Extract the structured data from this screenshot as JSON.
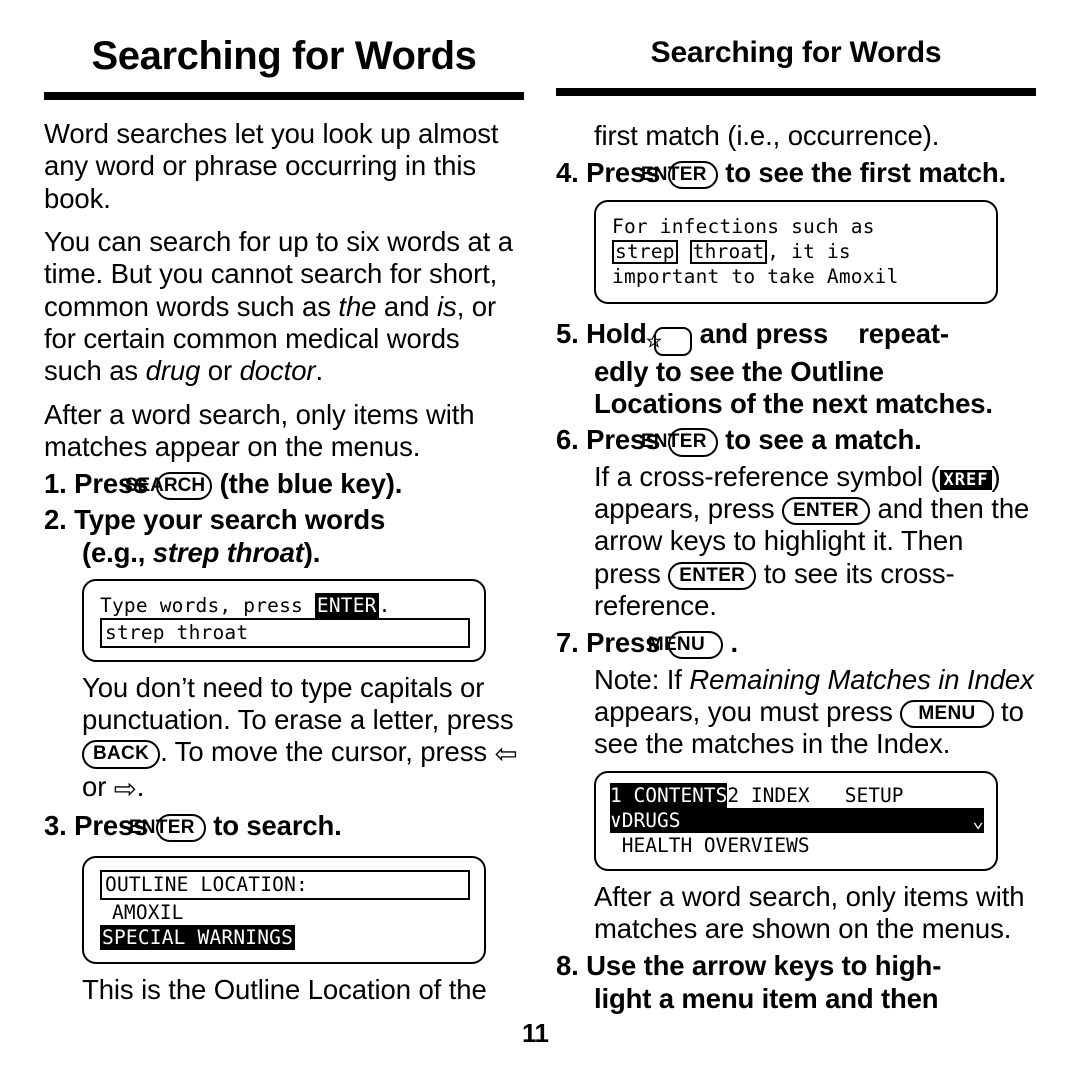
{
  "page": {
    "number": "11"
  },
  "left_column": {
    "heading": "Searching for Words",
    "intro_1": "Word searches let you look up almost any word or phrase occurring in this book.",
    "intro_2_a": "You can search for up to six words at a time. But you cannot search for short, common words such as ",
    "intro_2_i1": "the",
    "intro_2_b": " and ",
    "intro_2_i2": "is",
    "intro_2_c": ", or for certain common medical words such as ",
    "intro_2_i3": "drug",
    "intro_2_d": " or ",
    "intro_2_i4": "doctor",
    "intro_2_e": ".",
    "intro_3": "After a word search, only items with matches appear on the menus.",
    "step1": {
      "num": "1.",
      "pre": "Press",
      "key": "SEARCH",
      "post": "(the blue key)."
    },
    "step2": {
      "num": "2.",
      "line1": "Type your search words",
      "line2_pre": "(e.g., ",
      "line2_ital": "strep throat",
      "line2_post": ")."
    },
    "lcd_type": {
      "line1_a": "Type words, press ",
      "line1_key": "ENTER",
      "line1_b": ".",
      "field_value": "strep throat"
    },
    "note_after_lcd_a": "You don’t need to type capitals or punctuation. To erase a letter, press ",
    "note_after_lcd_key": "BACK",
    "note_after_lcd_b": ". To move the cursor, press ",
    "note_arrow_left": "⇦",
    "note_after_lcd_c": " or ",
    "note_arrow_right": "⇨",
    "note_after_lcd_d": ".",
    "step3": {
      "num": "3.",
      "pre": "Press",
      "key": "ENTER",
      "post": "to search."
    },
    "lcd_outline": {
      "header": "OUTLINE LOCATION:",
      "row1": "AMOXIL",
      "row2": "SPECIAL WARNINGS"
    },
    "closing": "This is the Outline Location of the"
  },
  "right_column": {
    "heading": "Searching for Words",
    "cont_line": "first match (i.e., occurrence).",
    "step4": {
      "num": "4.",
      "pre": "Press",
      "key": "ENTER",
      "post": "to see the first match."
    },
    "lcd_match": {
      "line1": "For infections such as",
      "line2_hl1": "strep",
      "line2_hl2": "throat",
      "line2_tail": ", it is",
      "line3": "important to take Amoxil"
    },
    "step5": {
      "num": "5.",
      "pre": "Hold",
      "key_icon": "star-key",
      "mid": "and press",
      "post": "repeat-",
      "line2": "edly to see the Outline",
      "line3": "Locations of the next matches."
    },
    "step6": {
      "num": "6.",
      "pre": "Press",
      "key": "ENTER",
      "post": "to see a match."
    },
    "xref_note_a": "If a cross-reference symbol (",
    "xref_chip": "XREF",
    "xref_note_b": ") appears, press ",
    "xref_key1": "ENTER",
    "xref_note_c": " and then the arrow keys to highlight it. Then press ",
    "xref_key2": "ENTER",
    "xref_note_d": " to see its cross-reference.",
    "step7": {
      "num": "7.",
      "pre": "Press",
      "key": "MENU",
      "post": "."
    },
    "note7_a": "Note: If ",
    "note7_ital": "Remaining Matches in Index",
    "note7_b": " appears, you must press ",
    "note7_key": "MENU",
    "note7_c": " to see the matches in the Index.",
    "lcd_menu": {
      "tab1": "1 CONTENTS",
      "tab2": "2 INDEX   SETUP",
      "row1": "∨DRUGS",
      "row1_right": "⌄",
      "row2": " HEALTH OVERVIEWS"
    },
    "closing": "After a word search, only items with matches are shown on the menus.",
    "step8": {
      "num": "8.",
      "line1": "Use the arrow keys to high-",
      "line2": "light a menu item and then"
    }
  }
}
